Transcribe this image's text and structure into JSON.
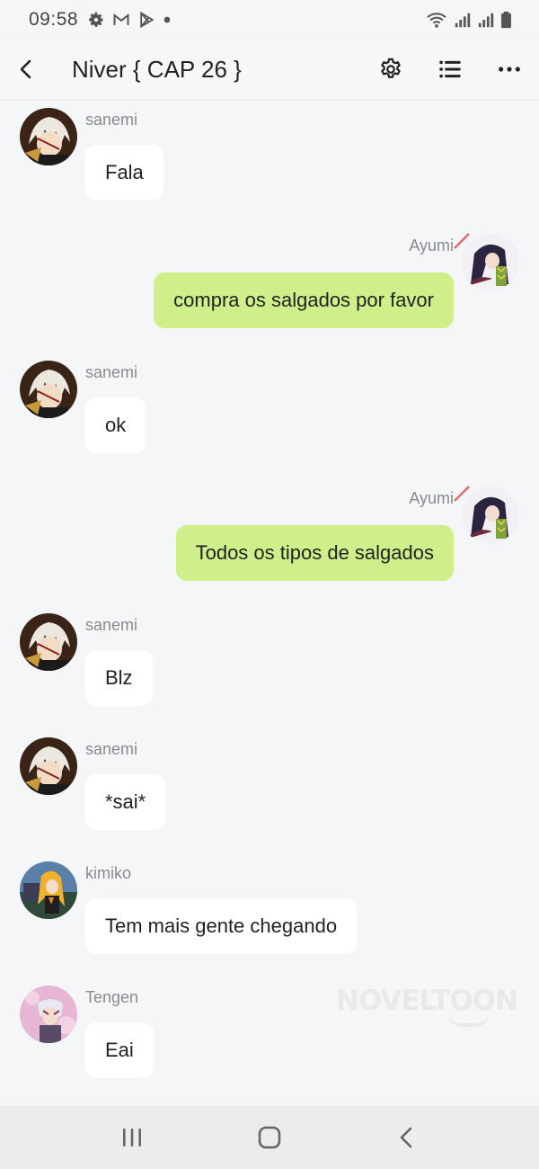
{
  "status_bar": {
    "time": "09:58",
    "left_icons": [
      "settings-icon",
      "gmail-icon",
      "play-store-icon",
      "dot-icon"
    ],
    "right_icons": [
      "wifi-icon",
      "signal-icon",
      "signal-icon",
      "battery-icon"
    ]
  },
  "header": {
    "title": "Niver { CAP 26 }",
    "back_icon": "chevron-left-icon",
    "settings_icon": "gear-icon",
    "list_icon": "list-icon",
    "more_icon": "more-horizontal-icon"
  },
  "messages": [
    {
      "side": "left",
      "sender": "sanemi",
      "text": "Fala"
    },
    {
      "side": "right",
      "sender": "Ayumi",
      "text": "compra os salgados por favor"
    },
    {
      "side": "left",
      "sender": "sanemi",
      "text": "ok"
    },
    {
      "side": "right",
      "sender": "Ayumi",
      "text": "Todos os tipos de salgados"
    },
    {
      "side": "left",
      "sender": "sanemi",
      "text": "Blz"
    },
    {
      "side": "left",
      "sender": "sanemi",
      "text": "*sai*"
    },
    {
      "side": "left",
      "sender": "kimiko",
      "text": "Tem mais gente chegando"
    },
    {
      "side": "left",
      "sender": "Tengen",
      "text": "Eai"
    }
  ],
  "watermark": "NOVELTOON",
  "colors": {
    "right_bubble": "#cfef8a",
    "left_bubble": "#ffffff",
    "background": "#f5f6f8"
  },
  "navbar": {
    "icons": [
      "recent-apps-icon",
      "home-icon",
      "back-icon"
    ]
  }
}
